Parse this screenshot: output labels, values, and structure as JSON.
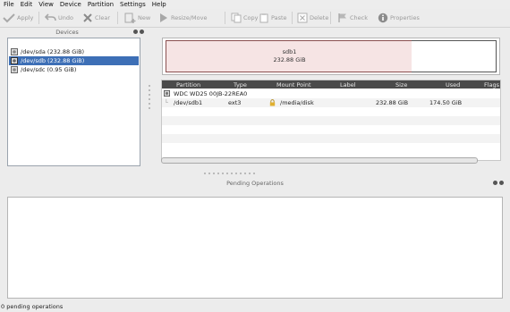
{
  "menu": [
    "File",
    "Edit",
    "View",
    "Device",
    "Partition",
    "Settings",
    "Help"
  ],
  "toolbar": {
    "apply": "Apply",
    "undo": "Undo",
    "clear": "Clear",
    "new": "New",
    "resize": "Resize/Move",
    "copy": "Copy",
    "paste": "Paste",
    "delete": "Delete",
    "check": "Check",
    "properties": "Properties"
  },
  "devices": {
    "title": "Devices",
    "items": [
      {
        "label": "/dev/sda (232.88 GiB)",
        "selected": false
      },
      {
        "label": "/dev/sdb (232.88 GiB)",
        "selected": true
      },
      {
        "label": "/dev/sdc (0.95 GiB)",
        "selected": false
      }
    ]
  },
  "diskmap": {
    "partition_name": "sdb1",
    "partition_size": "232.88 GiB"
  },
  "table": {
    "columns": [
      "Partition",
      "Type",
      "Mount Point",
      "Label",
      "Size",
      "Used",
      "Flags"
    ],
    "disk_row": "WDC WD25 00JB-22REA0",
    "rows": [
      {
        "partition": "/dev/sdb1",
        "type": "ext3",
        "mount": "/media/disk",
        "label": "",
        "size": "232.88 GiB",
        "used": "174.50 GiB",
        "flags": ""
      }
    ]
  },
  "pending": {
    "title": "Pending Operations"
  },
  "status": "0 pending operations",
  "colors": {
    "selection": "#3d6fb6",
    "partition_fill": "#f6e4e4",
    "partition_border": "#8a5050",
    "header_bg": "#4a4a4a"
  }
}
